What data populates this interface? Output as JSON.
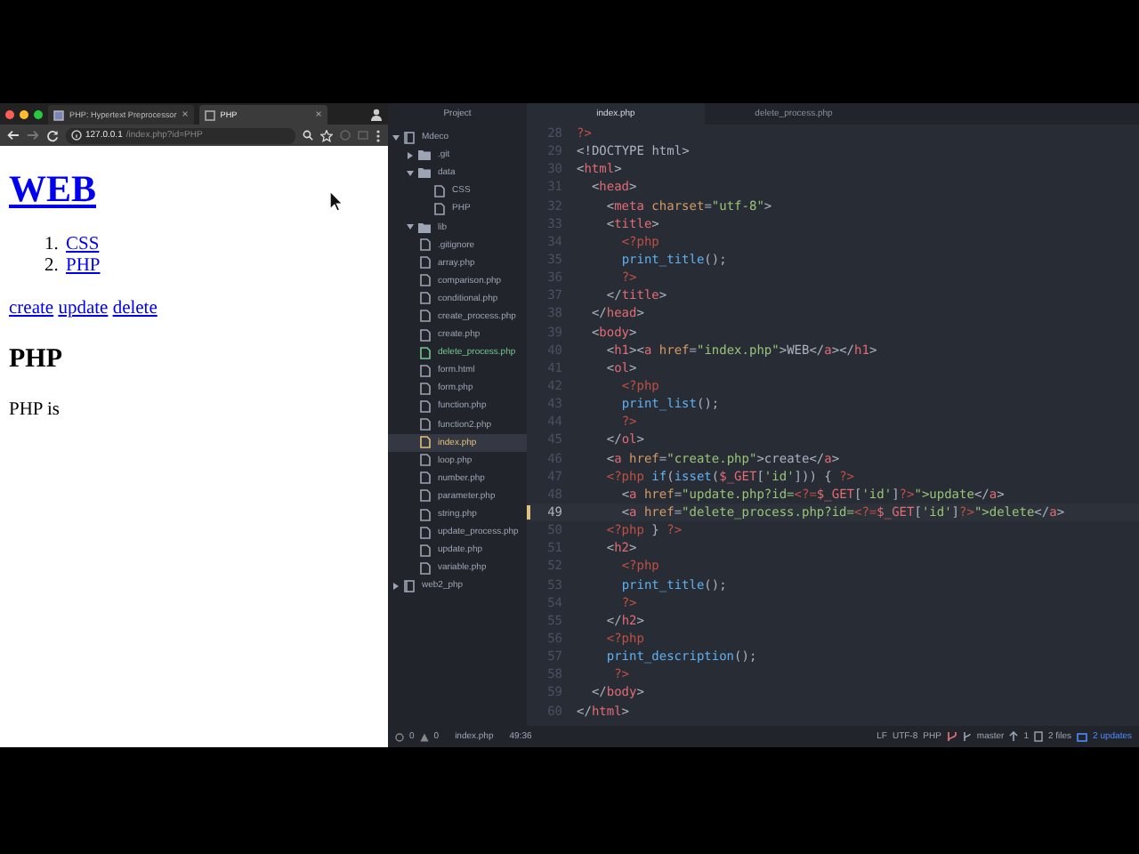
{
  "browser": {
    "tabs": [
      {
        "title": "PHP: Hypertext Preprocessor",
        "close": "×",
        "selected": false
      },
      {
        "title": "PHP",
        "close": "×",
        "selected": true
      }
    ],
    "url": {
      "host": "127.0.0.1",
      "path": "/index.php?id=PHP"
    },
    "page": {
      "heading": "WEB",
      "list": [
        {
          "marker": "1.",
          "text": "CSS"
        },
        {
          "marker": "2.",
          "text": "PHP"
        }
      ],
      "links": [
        "create",
        "update",
        "delete"
      ],
      "title": "PHP",
      "description": "PHP is"
    }
  },
  "editor": {
    "panel_title": "Project",
    "tabs": [
      {
        "title": "index.php",
        "selected": true
      },
      {
        "title": "delete_process.php",
        "selected": false
      }
    ],
    "tree": [
      {
        "name": "Mdeco",
        "kind": "repo",
        "expanded": true,
        "children": [
          {
            "name": ".git",
            "kind": "folder",
            "expanded": false
          },
          {
            "name": "data",
            "kind": "folder",
            "expanded": true,
            "children": [
              {
                "name": "CSS",
                "kind": "file",
                "added": false,
                "selected": false
              },
              {
                "name": "PHP",
                "kind": "file",
                "added": false,
                "selected": false
              }
            ]
          },
          {
            "name": "lib",
            "kind": "folder",
            "expanded": true
          },
          {
            "name": ".gitignore",
            "kind": "file",
            "added": false,
            "selected": false
          },
          {
            "name": "array.php",
            "kind": "file",
            "added": false,
            "selected": false
          },
          {
            "name": "comparison.php",
            "kind": "file",
            "added": false,
            "selected": false
          },
          {
            "name": "conditional.php",
            "kind": "file",
            "added": false,
            "selected": false
          },
          {
            "name": "create_process.php",
            "kind": "file",
            "added": false,
            "selected": false
          },
          {
            "name": "create.php",
            "kind": "file",
            "added": false,
            "selected": false
          },
          {
            "name": "delete_process.php",
            "kind": "file",
            "added": true,
            "selected": false
          },
          {
            "name": "form.html",
            "kind": "file",
            "added": false,
            "selected": false
          },
          {
            "name": "form.php",
            "kind": "file",
            "added": false,
            "selected": false
          },
          {
            "name": "function.php",
            "kind": "file",
            "added": false,
            "selected": false
          },
          {
            "name": "function2.php",
            "kind": "file",
            "added": false,
            "selected": false
          },
          {
            "name": "index.php",
            "kind": "file",
            "added": false,
            "selected": true
          },
          {
            "name": "loop.php",
            "kind": "file",
            "added": false,
            "selected": false
          },
          {
            "name": "number.php",
            "kind": "file",
            "added": false,
            "selected": false
          },
          {
            "name": "parameter.php",
            "kind": "file",
            "added": false,
            "selected": false
          },
          {
            "name": "string.php",
            "kind": "file",
            "added": false,
            "selected": false
          },
          {
            "name": "update_process.php",
            "kind": "file",
            "added": false,
            "selected": false
          },
          {
            "name": "update.php",
            "kind": "file",
            "added": false,
            "selected": false
          },
          {
            "name": "variable.php",
            "kind": "file",
            "added": false,
            "selected": false
          }
        ]
      },
      {
        "name": "web2_php",
        "kind": "repo",
        "expanded": false
      }
    ],
    "code": {
      "lines": [
        {
          "number": "28",
          "text": "?>",
          "current": false
        },
        {
          "number": "29",
          "text": "<!DOCTYPE html>",
          "current": false
        },
        {
          "number": "30",
          "text": "<html>",
          "current": false
        },
        {
          "number": "31",
          "text": "  <head>",
          "current": false
        },
        {
          "number": "32",
          "text": "    <meta charset=\"utf-8\">",
          "current": false
        },
        {
          "number": "33",
          "text": "    <title>",
          "current": false
        },
        {
          "number": "34",
          "text": "      <?php",
          "current": false
        },
        {
          "number": "35",
          "text": "      print_title();",
          "current": false
        },
        {
          "number": "36",
          "text": "      ?>",
          "current": false
        },
        {
          "number": "37",
          "text": "    </title>",
          "current": false
        },
        {
          "number": "38",
          "text": "  </head>",
          "current": false
        },
        {
          "number": "39",
          "text": "  <body>",
          "current": false
        },
        {
          "number": "40",
          "text": "    <h1><a href=\"index.php\">WEB</a></h1>",
          "current": false
        },
        {
          "number": "41",
          "text": "    <ol>",
          "current": false
        },
        {
          "number": "42",
          "text": "      <?php",
          "current": false
        },
        {
          "number": "43",
          "text": "      print_list();",
          "current": false
        },
        {
          "number": "44",
          "text": "      ?>",
          "current": false
        },
        {
          "number": "45",
          "text": "    </ol>",
          "current": false
        },
        {
          "number": "46",
          "text": "    <a href=\"create.php\">create</a>",
          "current": false
        },
        {
          "number": "47",
          "text": "    <?php if(isset($_GET['id'])) { ?>",
          "current": false
        },
        {
          "number": "48",
          "text": "      <a href=\"update.php?id=<?=$_GET['id']?>\">update</a>",
          "current": false
        },
        {
          "number": "49",
          "text": "      <a href=\"delete_process.php?id=<?=$_GET['id']?>\">delete</a>",
          "current": true
        },
        {
          "number": "50",
          "text": "    <?php } ?>",
          "current": false
        },
        {
          "number": "51",
          "text": "    <h2>",
          "current": false
        },
        {
          "number": "52",
          "text": "      <?php",
          "current": false
        },
        {
          "number": "53",
          "text": "      print_title();",
          "current": false
        },
        {
          "number": "54",
          "text": "      ?>",
          "current": false
        },
        {
          "number": "55",
          "text": "    </h2>",
          "current": false
        },
        {
          "number": "56",
          "text": "    <?php",
          "current": false
        },
        {
          "number": "57",
          "text": "    print_description();",
          "current": false
        },
        {
          "number": "58",
          "text": "     ?>",
          "current": false
        },
        {
          "number": "59",
          "text": "  </body>",
          "current": false
        },
        {
          "number": "60",
          "text": "</html>",
          "current": false
        }
      ]
    },
    "status_bar": {
      "errors": "0",
      "warnings": "0",
      "file": "index.php",
      "cursor": "49:36",
      "line_ending": "LF",
      "encoding": "UTF-8",
      "grammar": "PHP",
      "branch": "master",
      "ahead": "1",
      "changes": "2 files",
      "updates": "2 updates"
    }
  }
}
